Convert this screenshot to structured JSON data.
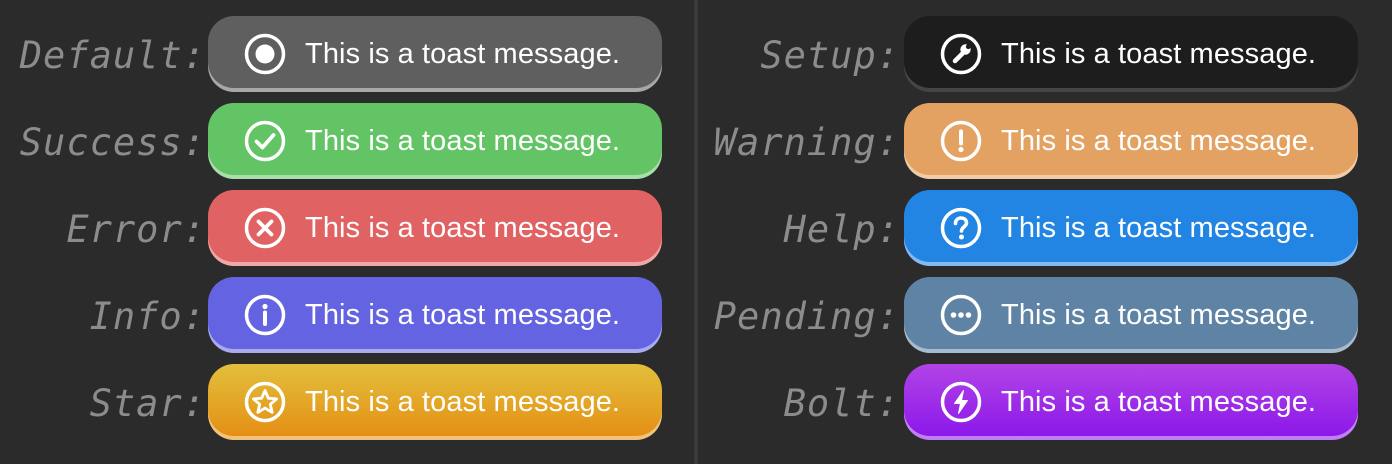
{
  "left_column": [
    {
      "label": "Default:",
      "message": "This is a toast message.",
      "icon": "record-icon",
      "color": "#5f5f5f"
    },
    {
      "label": "Success:",
      "message": "This is a toast message.",
      "icon": "check-circle-icon",
      "color": "#63c466"
    },
    {
      "label": "Error:",
      "message": "This is a toast message.",
      "icon": "close-circle-icon",
      "color": "#e16263"
    },
    {
      "label": "Info:",
      "message": "This is a toast message.",
      "icon": "info-icon",
      "color": "#6464e2"
    },
    {
      "label": "Star:",
      "message": "This is a toast message.",
      "icon": "star-icon",
      "color": "#e5a522"
    }
  ],
  "right_column": [
    {
      "label": "Setup:",
      "message": "This is a toast message.",
      "icon": "wrench-icon",
      "color": "#1d1d1d"
    },
    {
      "label": "Warning:",
      "message": "This is a toast message.",
      "icon": "exclamation-icon",
      "color": "#e4a262"
    },
    {
      "label": "Help:",
      "message": "This is a toast message.",
      "icon": "question-icon",
      "color": "#2284e3"
    },
    {
      "label": "Pending:",
      "message": "This is a toast message.",
      "icon": "ellipsis-icon",
      "color": "#5f83a4"
    },
    {
      "label": "Bolt:",
      "message": "This is a toast message.",
      "icon": "bolt-icon",
      "color": "#9a22ea"
    }
  ]
}
